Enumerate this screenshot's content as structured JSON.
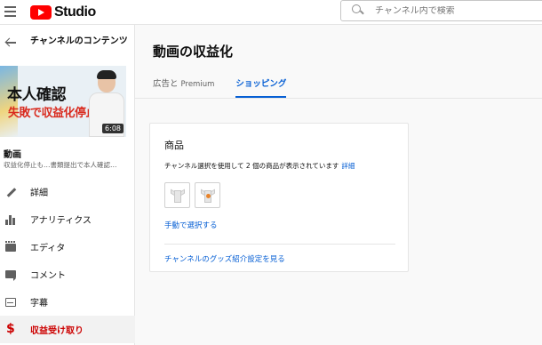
{
  "header": {
    "menu_icon": "hamburger-icon",
    "logo_text": "Studio",
    "search": {
      "placeholder": "チャンネル内で検索",
      "icon": "search-icon"
    }
  },
  "sidebar": {
    "back_title": "チャンネルのコンテンツ",
    "thumbnail": {
      "line1": "本人確認",
      "line2": "失敗で収益化停止？",
      "duration": "6:08"
    },
    "video_label": "動画",
    "video_subtitle": "収益化停止も…書類提出で本人確認…",
    "items": [
      {
        "label": "詳細",
        "icon": "pencil-icon"
      },
      {
        "label": "アナリティクス",
        "icon": "analytics-icon"
      },
      {
        "label": "エディタ",
        "icon": "editor-icon"
      },
      {
        "label": "コメント",
        "icon": "comment-icon"
      },
      {
        "label": "字幕",
        "icon": "subtitles-icon"
      },
      {
        "label": "収益受け取り",
        "icon": "dollar-icon",
        "active": true
      }
    ]
  },
  "main": {
    "title": "動画の収益化",
    "tabs": [
      {
        "label": "広告と",
        "label_en": "Premium"
      },
      {
        "label": "ショッピング",
        "active": true
      }
    ],
    "card": {
      "title": "商品",
      "description": "チャンネル選択を使用して 2 個の商品が表示されています",
      "details_link": "詳細",
      "manual_select": "手動で選択する",
      "goods_link": "チャンネルのグッズ紹介設定を見る"
    }
  },
  "colors": {
    "accent_blue": "#065fd4",
    "active_red": "#cc0000",
    "brand_red": "#ff0000"
  }
}
